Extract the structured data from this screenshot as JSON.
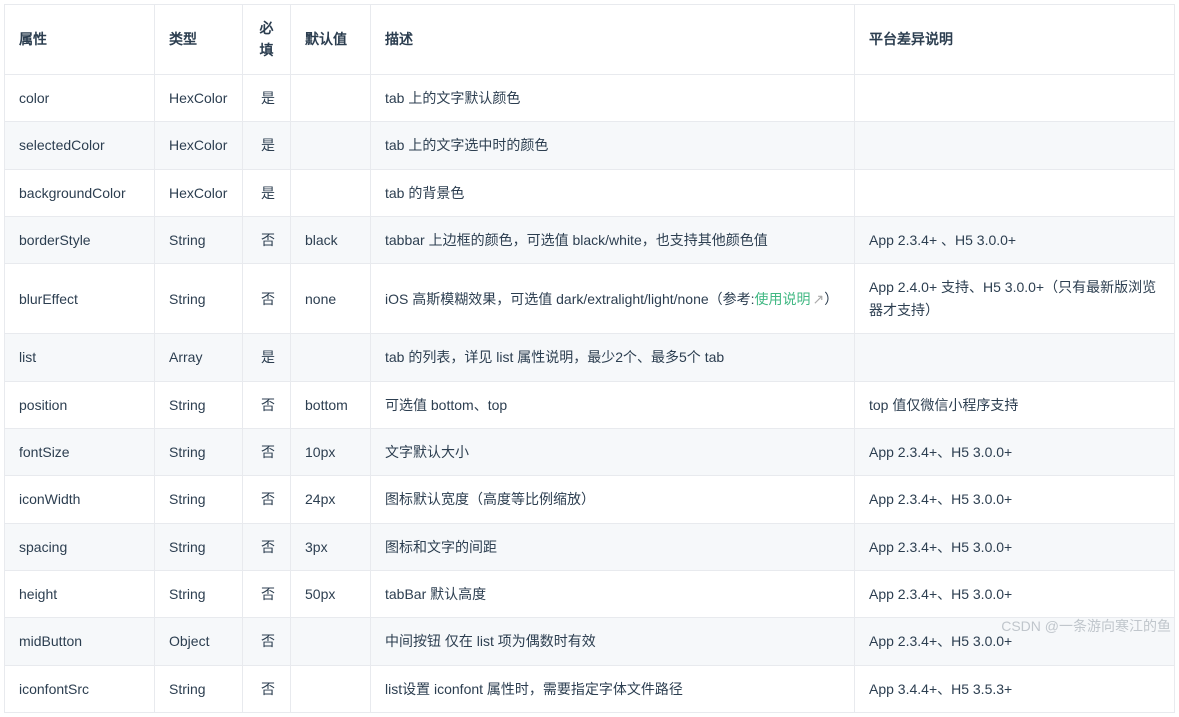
{
  "table": {
    "headers": {
      "attr": "属性",
      "type": "类型",
      "required": "必填",
      "default": "默认值",
      "desc": "描述",
      "platform": "平台差异说明"
    },
    "rows": [
      {
        "attr": "color",
        "type": "HexColor",
        "required": "是",
        "default": "",
        "desc": "tab 上的文字默认颜色",
        "platform": ""
      },
      {
        "attr": "selectedColor",
        "type": "HexColor",
        "required": "是",
        "default": "",
        "desc": "tab 上的文字选中时的颜色",
        "platform": ""
      },
      {
        "attr": "backgroundColor",
        "type": "HexColor",
        "required": "是",
        "default": "",
        "desc": "tab 的背景色",
        "platform": ""
      },
      {
        "attr": "borderStyle",
        "type": "String",
        "required": "否",
        "default": "black",
        "desc": "tabbar 上边框的颜色，可选值 black/white，也支持其他颜色值",
        "platform": "App 2.3.4+ 、H5 3.0.0+"
      },
      {
        "attr": "blurEffect",
        "type": "String",
        "required": "否",
        "default": "none",
        "desc_pre": "iOS 高斯模糊效果，可选值 dark/extralight/light/none（参考:",
        "desc_link": "使用说明",
        "desc_post": "）",
        "platform": "App 2.4.0+ 支持、H5 3.0.0+（只有最新版浏览器才支持）"
      },
      {
        "attr": "list",
        "type": "Array",
        "required": "是",
        "default": "",
        "desc": "tab 的列表，详见 list 属性说明，最少2个、最多5个 tab",
        "platform": ""
      },
      {
        "attr": "position",
        "type": "String",
        "required": "否",
        "default": "bottom",
        "desc": "可选值 bottom、top",
        "platform": "top 值仅微信小程序支持"
      },
      {
        "attr": "fontSize",
        "type": "String",
        "required": "否",
        "default": "10px",
        "desc": "文字默认大小",
        "platform": "App 2.3.4+、H5 3.0.0+"
      },
      {
        "attr": "iconWidth",
        "type": "String",
        "required": "否",
        "default": "24px",
        "desc": "图标默认宽度（高度等比例缩放）",
        "platform": "App 2.3.4+、H5 3.0.0+"
      },
      {
        "attr": "spacing",
        "type": "String",
        "required": "否",
        "default": "3px",
        "desc": "图标和文字的间距",
        "platform": "App 2.3.4+、H5 3.0.0+"
      },
      {
        "attr": "height",
        "type": "String",
        "required": "否",
        "default": "50px",
        "desc": "tabBar 默认高度",
        "platform": "App 2.3.4+、H5 3.0.0+"
      },
      {
        "attr": "midButton",
        "type": "Object",
        "required": "否",
        "default": "",
        "desc": "中间按钮 仅在 list 项为偶数时有效",
        "platform": "App 2.3.4+、H5 3.0.0+"
      },
      {
        "attr": "iconfontSrc",
        "type": "String",
        "required": "否",
        "default": "",
        "desc": "list设置 iconfont 属性时，需要指定字体文件路径",
        "platform": "App 3.4.4+、H5 3.5.3+"
      }
    ]
  },
  "watermark": "CSDN @一条游向寒江的鱼"
}
